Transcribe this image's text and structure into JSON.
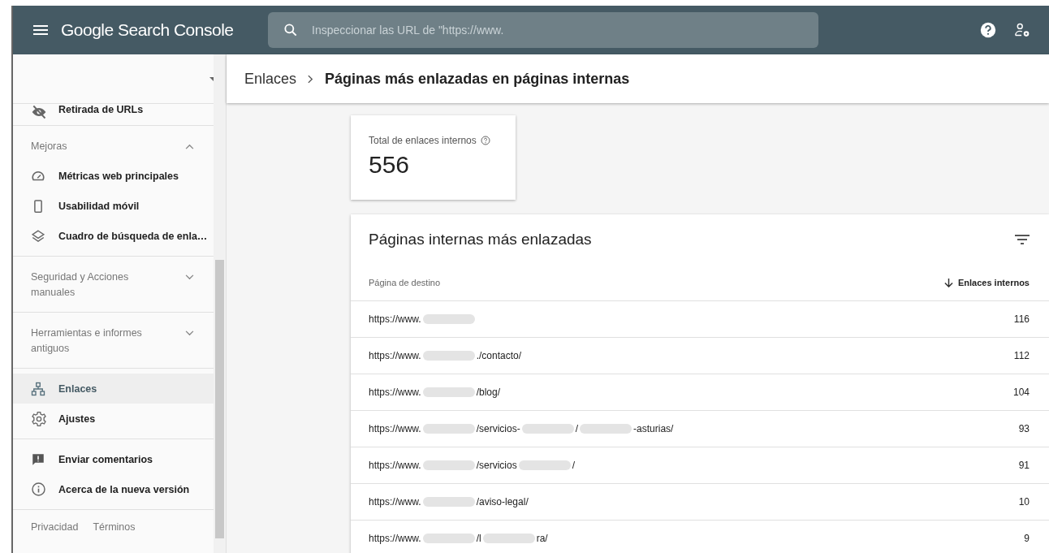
{
  "header": {
    "product": "Google Search Console",
    "search": {
      "placeholder": "Inspeccionar las URL de \"https://www."
    }
  },
  "sidebar": {
    "groups": [
      {
        "kind": "items",
        "items": [
          {
            "label": "Retirada de URLs",
            "selected": false
          }
        ]
      },
      {
        "kind": "section",
        "title": "Mejoras",
        "expanded": true,
        "items": [
          {
            "label": "Métricas web principales",
            "selected": false
          },
          {
            "label": "Usabilidad móvil",
            "selected": false
          },
          {
            "label": "Cuadro de búsqueda de enla…",
            "selected": false
          }
        ]
      },
      {
        "kind": "section",
        "title": "Seguridad y Acciones manuales",
        "expanded": false
      },
      {
        "kind": "section",
        "title": "Herramientas e informes antiguos",
        "expanded": false
      },
      {
        "kind": "items",
        "items": [
          {
            "label": "Enlaces",
            "selected": true
          },
          {
            "label": "Ajustes",
            "selected": false
          }
        ]
      },
      {
        "kind": "items",
        "items": [
          {
            "label": "Enviar comentarios",
            "selected": false
          },
          {
            "label": "Acerca de la nueva versión",
            "selected": false
          }
        ]
      }
    ],
    "footer": [
      "Privacidad",
      "Términos"
    ]
  },
  "breadcrumb": {
    "parent": "Enlaces",
    "current": "Páginas más enlazadas en páginas internas"
  },
  "total_card": {
    "label": "Total de enlaces internos",
    "value": "556"
  },
  "table": {
    "title": "Páginas internas más enlazadas",
    "columns": [
      "Página de destino",
      "Enlaces internos"
    ],
    "rows": [
      {
        "url": [
          {
            "kind": "text",
            "text": "https://www."
          },
          {
            "kind": "redacted"
          }
        ],
        "count": "116"
      },
      {
        "url": [
          {
            "kind": "text",
            "text": "https://www."
          },
          {
            "kind": "redacted"
          },
          {
            "kind": "text",
            "text": "./contacto/"
          }
        ],
        "count": "112"
      },
      {
        "url": [
          {
            "kind": "text",
            "text": "https://www."
          },
          {
            "kind": "redacted"
          },
          {
            "kind": "text",
            "text": "/blog/"
          }
        ],
        "count": "104"
      },
      {
        "url": [
          {
            "kind": "text",
            "text": "https://www."
          },
          {
            "kind": "redacted"
          },
          {
            "kind": "text",
            "text": "/servicios-"
          },
          {
            "kind": "redacted"
          },
          {
            "kind": "text",
            "text": "/"
          },
          {
            "kind": "redacted"
          },
          {
            "kind": "text",
            "text": "-asturias/"
          }
        ],
        "count": "93"
      },
      {
        "url": [
          {
            "kind": "text",
            "text": "https://www."
          },
          {
            "kind": "redacted"
          },
          {
            "kind": "text",
            "text": "/servicios"
          },
          {
            "kind": "redacted"
          },
          {
            "kind": "text",
            "text": "/"
          }
        ],
        "count": "91"
      },
      {
        "url": [
          {
            "kind": "text",
            "text": "https://www."
          },
          {
            "kind": "redacted"
          },
          {
            "kind": "text",
            "text": "/aviso-legal/"
          }
        ],
        "count": "10"
      },
      {
        "url": [
          {
            "kind": "text",
            "text": "https://www."
          },
          {
            "kind": "redacted"
          },
          {
            "kind": "text",
            "text": "/l"
          },
          {
            "kind": "redacted"
          },
          {
            "kind": "text",
            "text": "ra/"
          }
        ],
        "count": "9"
      }
    ]
  }
}
